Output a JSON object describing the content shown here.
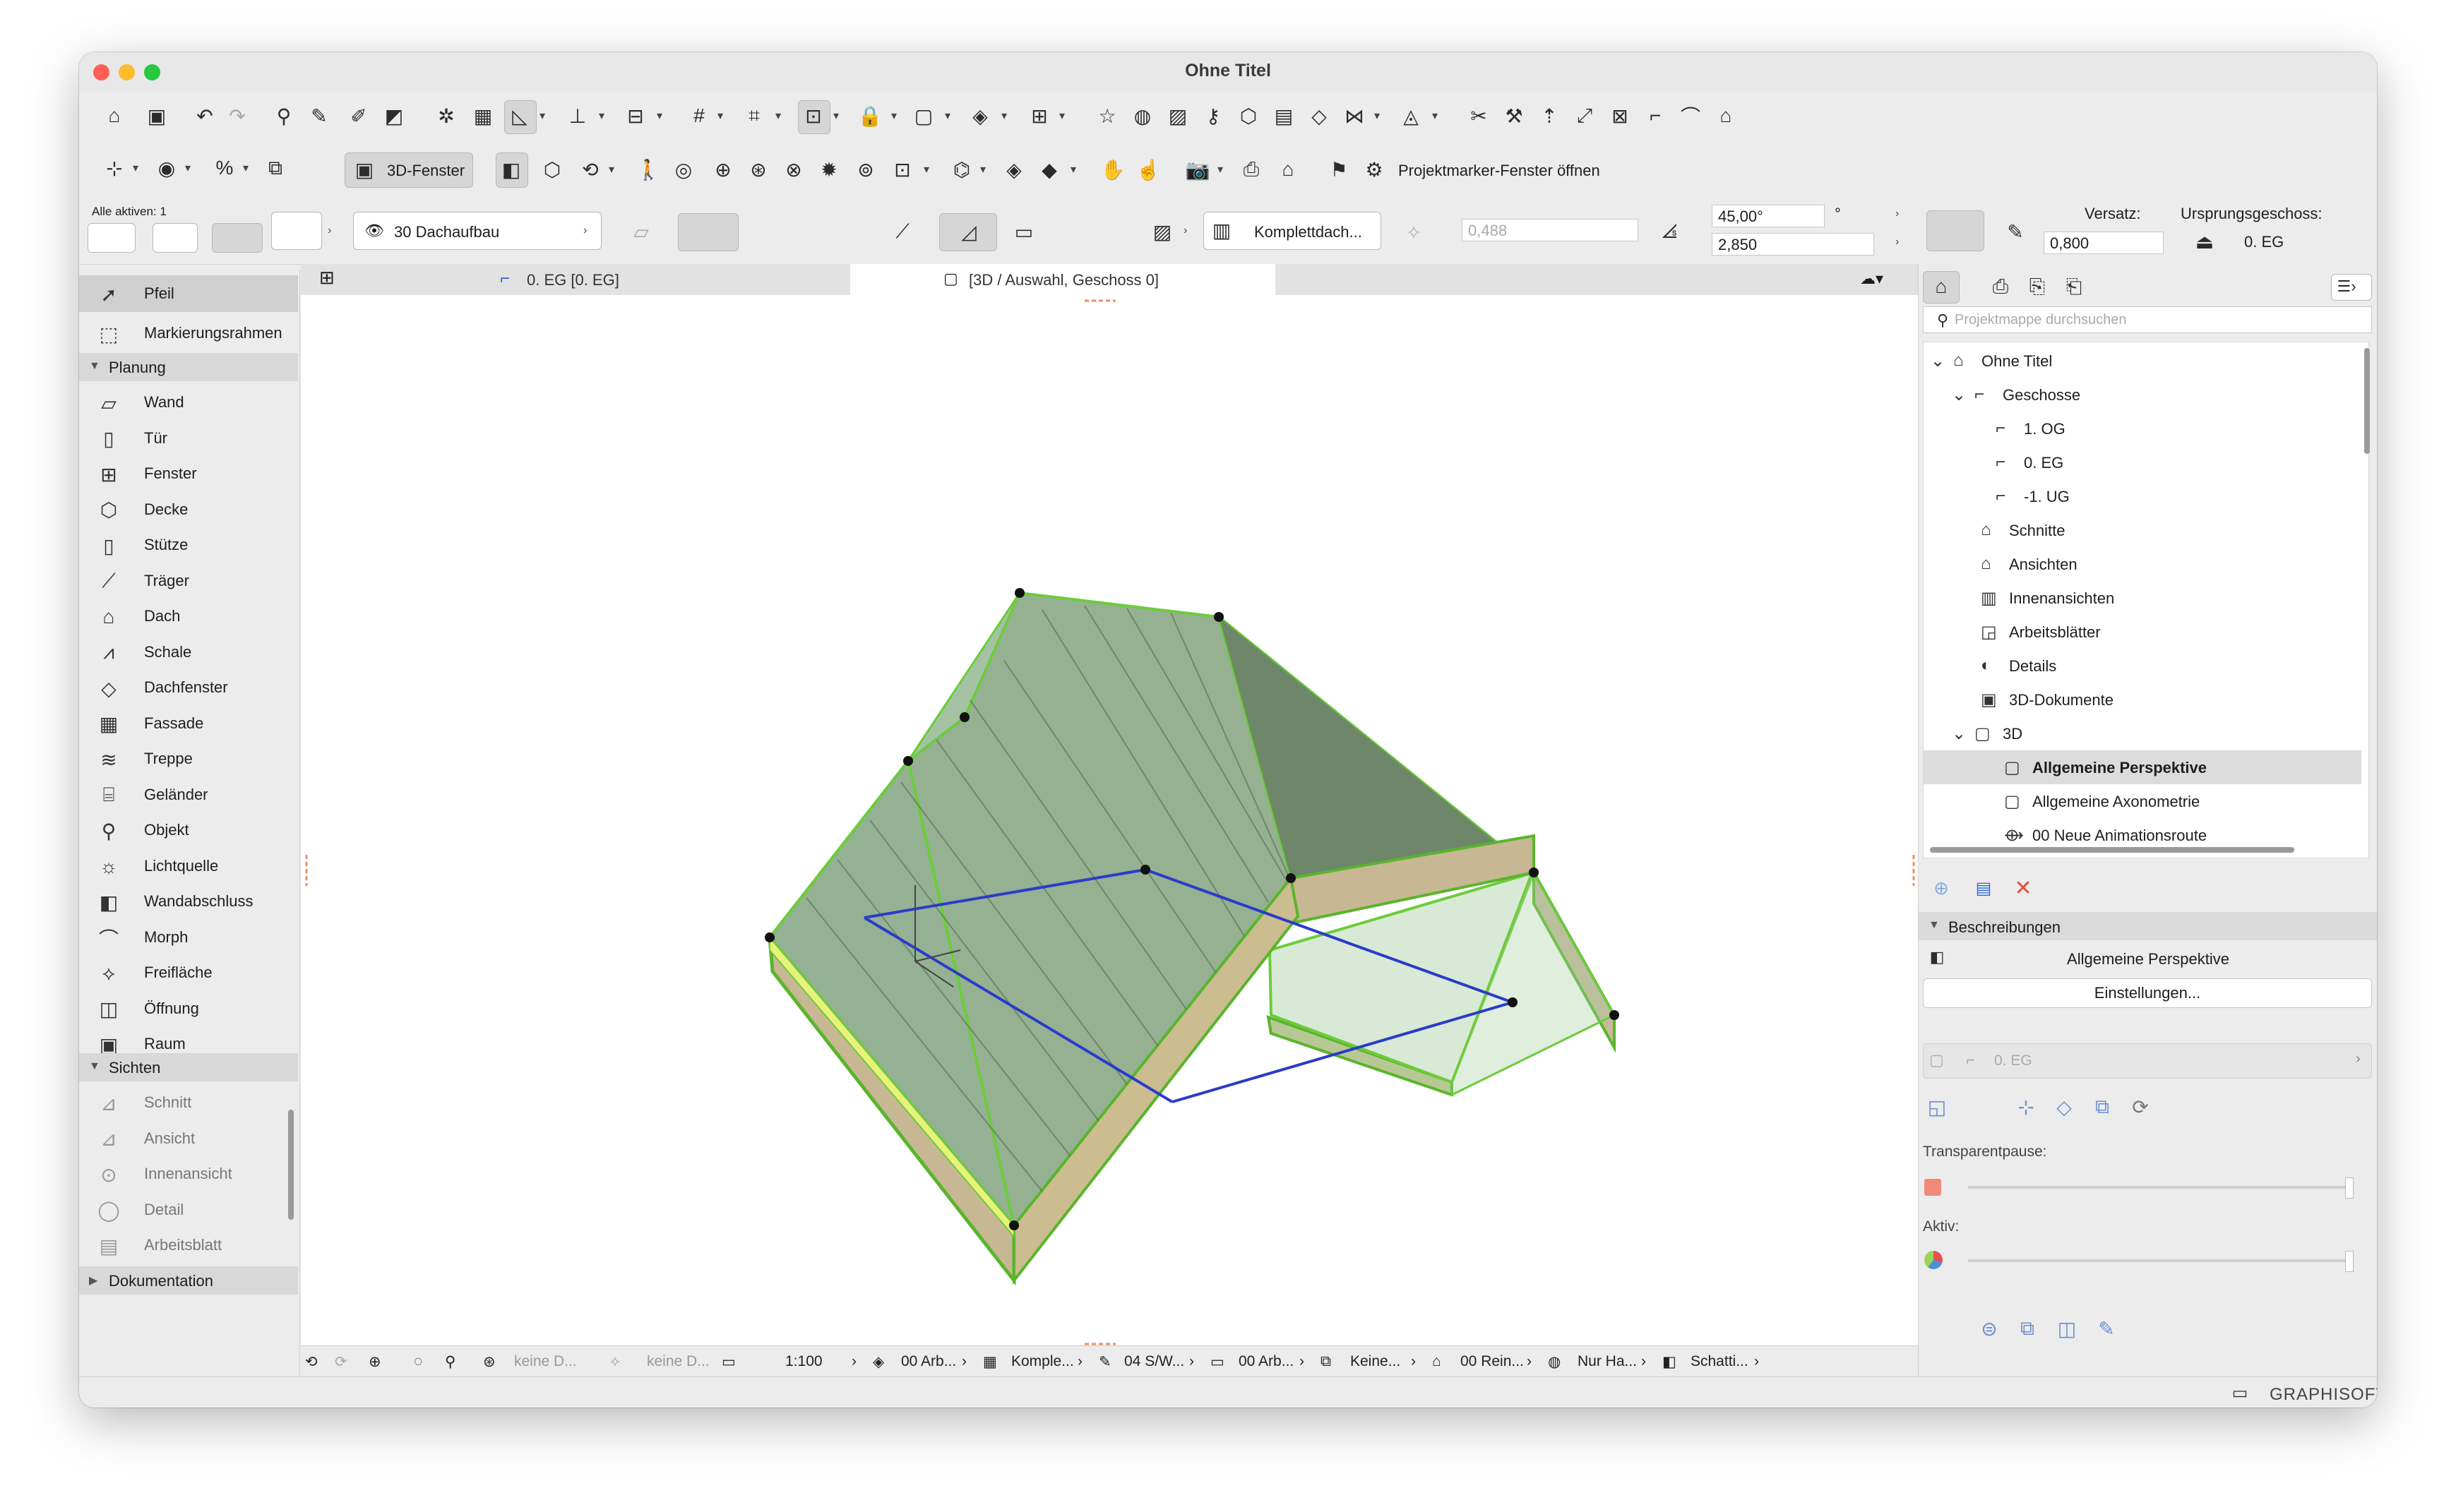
{
  "window": {
    "title": "Ohne Titel"
  },
  "toolbar2": {
    "view_3d": "3D-Fenster",
    "marker_label": "Projektmarker-Fenster öffnen"
  },
  "infobox": {
    "all_active": "Alle aktiven: 1",
    "layer": "30 Dachaufbau",
    "composite": "Komplettdach...",
    "thickness": "0,488",
    "angle": "45,00°",
    "angle_unit": "°",
    "height": "2,850",
    "offset_label": "Versatz:",
    "offset_value": "0,800",
    "origin_label": "Ursprungsgeschoss:",
    "origin_value": "0. EG"
  },
  "tabs": {
    "tab1": "0. EG [0. EG]",
    "tab2": "[3D / Auswahl, Geschoss 0]"
  },
  "sidebar": {
    "arrow": "Pfeil",
    "marquee": "Markierungsrahmen",
    "section_design": "Planung",
    "design_items": [
      "Wand",
      "Tür",
      "Fenster",
      "Decke",
      "Stütze",
      "Träger",
      "Dach",
      "Schale",
      "Dachfenster",
      "Fassade",
      "Treppe",
      "Geländer",
      "Objekt",
      "Lichtquelle",
      "Wandabschluss",
      "Morph",
      "Freifläche",
      "Öffnung",
      "Raum"
    ],
    "section_views": "Sichten",
    "view_items": [
      "Schnitt",
      "Ansicht",
      "Innenansicht",
      "Detail",
      "Arbeitsblatt"
    ],
    "section_doc": "Dokumentation"
  },
  "statusbar": {
    "layer_combo1": "keine D...",
    "layer_combo2": "keine D...",
    "scale": "1:100",
    "layer_combo": "00 Arb...",
    "structure": "Komple...",
    "pen_set": "04 S/W...",
    "model_view": "00 Arb...",
    "renovation": "Keine...",
    "renovation2": "00 Rein...",
    "surfaces": "Nur Ha...",
    "shading": "Schatti..."
  },
  "navigator": {
    "search_placeholder": "Projektmappe durchsuchen",
    "root": "Ohne Titel",
    "stories_label": "Geschosse",
    "stories": [
      "1. OG",
      "0. EG",
      "-1. UG"
    ],
    "sections": "Schnitte",
    "elevations": "Ansichten",
    "interior": "Innenansichten",
    "worksheets": "Arbeitsblätter",
    "details": "Details",
    "docs3d": "3D-Dokumente",
    "folder3d": "3D",
    "items3d": [
      "Allgemeine Perspektive",
      "Allgemeine Axonometrie",
      "00 Neue Animationsroute"
    ]
  },
  "props": {
    "desc_header": "Beschreibungen",
    "desc_name": "Allgemeine Perspektive",
    "settings_btn": "Einstellungen...",
    "story_value": "0. EG",
    "transparent_label": "Transparentpause:",
    "active_label": "Aktiv:"
  },
  "footer": {
    "brand": "GRAPHISOFT ID"
  },
  "colors": {
    "roof_fill": "#8fa98c",
    "roof_edge": "#6ccc3a",
    "outline_blue": "#2a3cc8",
    "selection_bar": "#dcdcdc"
  }
}
